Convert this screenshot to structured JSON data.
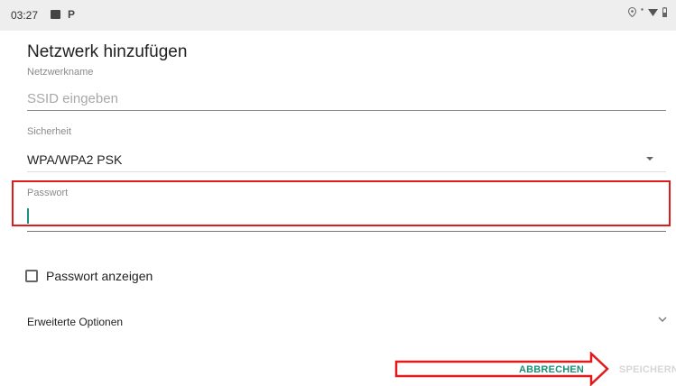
{
  "status_bar": {
    "time": "03:27",
    "icons_left": [
      "image-icon",
      "parking-icon"
    ],
    "icons_right": [
      "location-icon",
      "dot-icon",
      "wifi-icon",
      "battery-icon"
    ]
  },
  "dialog": {
    "title": "Netzwerk hinzufügen",
    "network_name": {
      "label": "Netzwerkname",
      "placeholder": "SSID eingeben",
      "value": ""
    },
    "security": {
      "label": "Sicherheit",
      "value": "WPA/WPA2 PSK"
    },
    "password": {
      "label": "Passwort",
      "value": ""
    },
    "show_password": {
      "label": "Passwort anzeigen",
      "checked": false
    },
    "advanced": {
      "label": "Erweiterte Optionen"
    },
    "buttons": {
      "cancel": "ABBRECHEN",
      "save": "SPEICHERN"
    }
  },
  "colors": {
    "accent": "#1a8f7a",
    "highlight": "#e11b1b",
    "disabled": "#d6d6d6"
  }
}
